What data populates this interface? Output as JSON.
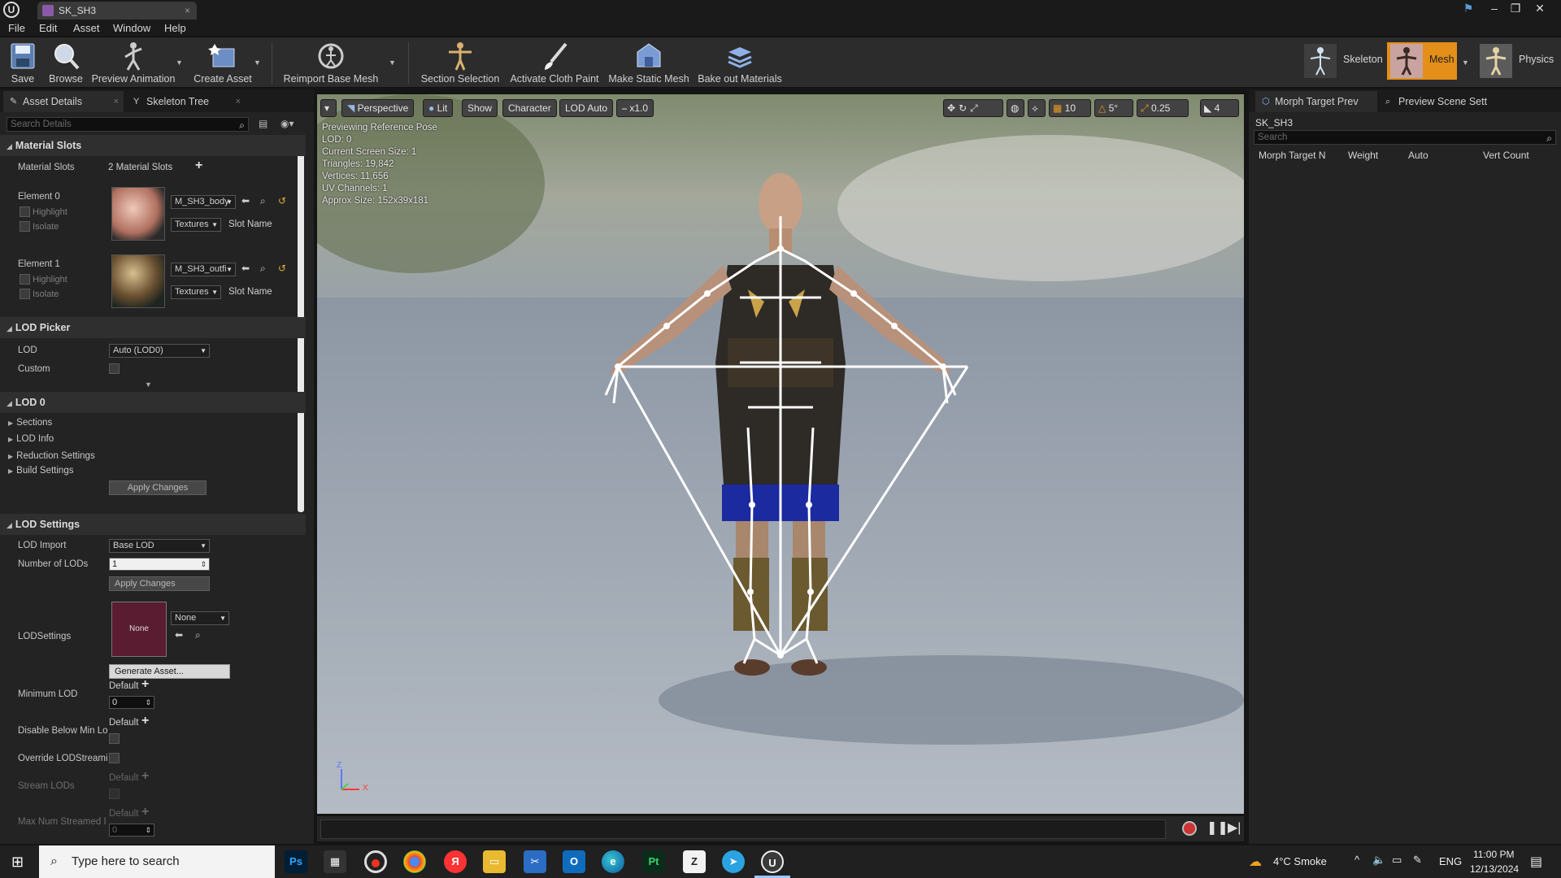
{
  "window": {
    "tab_title": "SK_SH3",
    "logo_letter": "U"
  },
  "menu": [
    "File",
    "Edit",
    "Asset",
    "Window",
    "Help"
  ],
  "toolbar": {
    "buttons": [
      "Save",
      "Browse",
      "Preview Animation",
      "Create Asset",
      "Reimport Base Mesh",
      "Section Selection",
      "Activate Cloth Paint",
      "Make Static Mesh",
      "Bake out Materials"
    ],
    "modes": [
      "Skeleton",
      "Mesh",
      "Physics"
    ]
  },
  "left_panel": {
    "tabs": [
      "Asset Details",
      "Skeleton Tree"
    ],
    "search_placeholder": "Search Details",
    "material_slots": {
      "header": "Material Slots",
      "label": "Material Slots",
      "count": "2 Material Slots",
      "elements": [
        {
          "name": "Element 0",
          "material": "M_SH3_body",
          "textures": "Textures",
          "slot": "Slot Name",
          "highlight": "Highlight",
          "isolate": "Isolate"
        },
        {
          "name": "Element 1",
          "material": "M_SH3_outfi",
          "textures": "Textures",
          "slot": "Slot Name",
          "highlight": "Highlight",
          "isolate": "Isolate"
        }
      ]
    },
    "lod_picker": {
      "header": "LOD Picker",
      "lod_label": "LOD",
      "lod_value": "Auto (LOD0)",
      "custom_label": "Custom"
    },
    "lod0": {
      "header": "LOD 0",
      "items": [
        "Sections",
        "LOD Info",
        "Reduction Settings",
        "Build Settings"
      ],
      "apply": "Apply Changes"
    },
    "lod_settings": {
      "header": "LOD Settings",
      "import_label": "LOD Import",
      "import_value": "Base LOD",
      "num_label": "Number of LODs",
      "num_value": "1",
      "apply": "Apply Changes",
      "settings_label": "LODSettings",
      "settings_thumb": "None",
      "settings_value": "None",
      "generate": "Generate Asset...",
      "min_lod_label": "Minimum LOD",
      "default": "Default",
      "min_lod_value": "0",
      "disable_label": "Disable Below Min Lo",
      "override_label": "Override LODStreami",
      "stream_label": "Stream LODs",
      "max_label": "Max Num Streamed I",
      "max_value": "0"
    }
  },
  "viewport": {
    "buttons": [
      "Perspective",
      "Lit",
      "Show",
      "Character",
      "LOD Auto",
      "x1.0"
    ],
    "right_values": [
      "10",
      "5°",
      "0.25",
      "4"
    ],
    "stats": [
      "Previewing Reference Pose",
      "LOD: 0",
      "Current Screen Size: 1",
      "Triangles: 19,842",
      "Vertices: 11,656",
      "UV Channels: 1",
      "Approx Size: 152x39x181"
    ],
    "axis_z": "Z",
    "axis_x": "X"
  },
  "right_panel": {
    "tabs": [
      "Morph Target Prev",
      "Preview Scene Sett"
    ],
    "asset_name": "SK_SH3",
    "search_placeholder": "Search",
    "columns": [
      "Morph Target N",
      "Weight",
      "Auto",
      "Vert Count"
    ]
  },
  "taskbar": {
    "search_placeholder": "Type here to search",
    "weather": "4°C  Smoke",
    "lang": "ENG",
    "time": "11:00 PM",
    "date": "12/13/2024"
  },
  "colors": {
    "accent_mode": "#d98a14",
    "panel_bg": "#232323",
    "sky_top": "#8a9585",
    "floor": "#8c96a3"
  }
}
